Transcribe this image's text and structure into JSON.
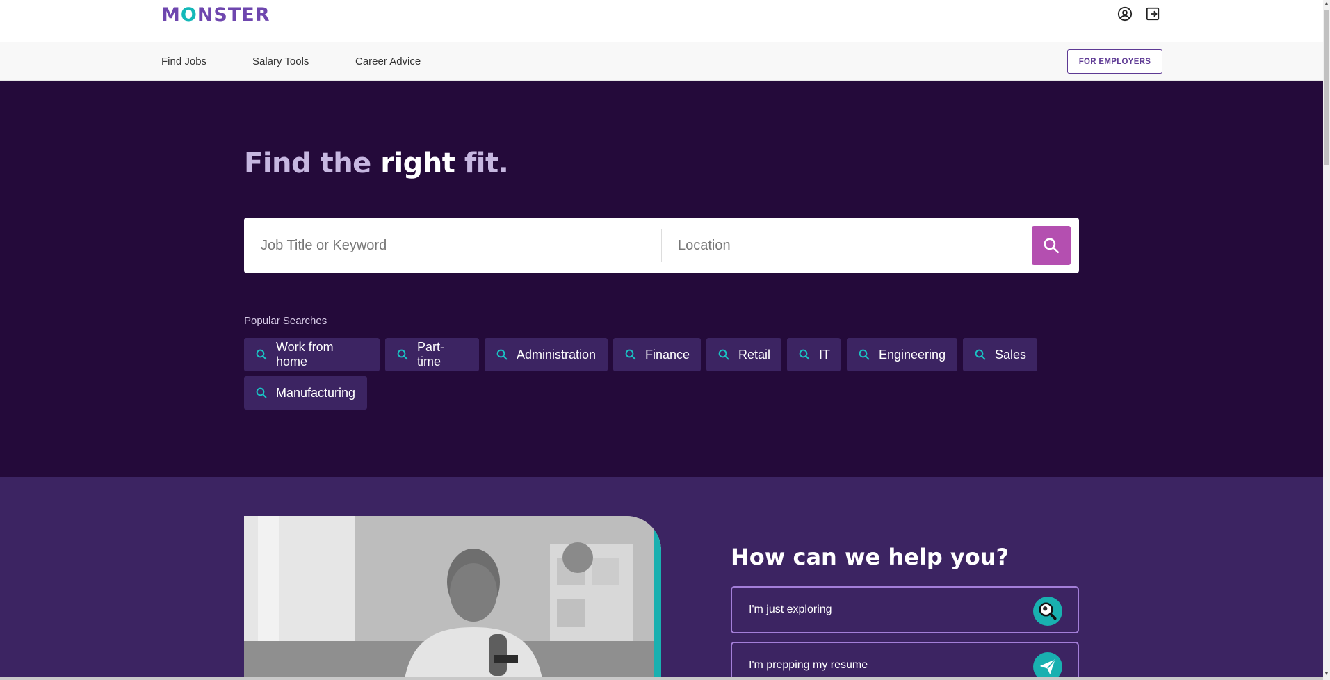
{
  "header": {
    "logo_text_m": "M",
    "logo_text_o": "O",
    "logo_text_rest": "NSTER",
    "icons": [
      "user-circle-icon",
      "sign-out-icon"
    ]
  },
  "nav": {
    "items": [
      "Find Jobs",
      "Salary Tools",
      "Career Advice"
    ],
    "employers_label": "FOR EMPLOYERS"
  },
  "hero": {
    "headline_pre": "Find the ",
    "headline_strong": "right",
    "headline_post": " fit.",
    "keyword_placeholder": "Job Title or Keyword",
    "location_placeholder": "Location",
    "popular_label": "Popular Searches",
    "popular": [
      "Work from home",
      "Part-time",
      "Administration",
      "Finance",
      "Retail",
      "IT",
      "Engineering",
      "Sales",
      "Manufacturing"
    ]
  },
  "help": {
    "title": "How can we help you?",
    "options": [
      "I'm just exploring",
      "I'm prepping my resume"
    ]
  },
  "colors": {
    "brand_purple": "#6e46ae",
    "hero_bg": "#240a3a",
    "section_bg": "#3c2462",
    "accent_teal": "#19b0b0",
    "search_button": "#b44fb0"
  }
}
